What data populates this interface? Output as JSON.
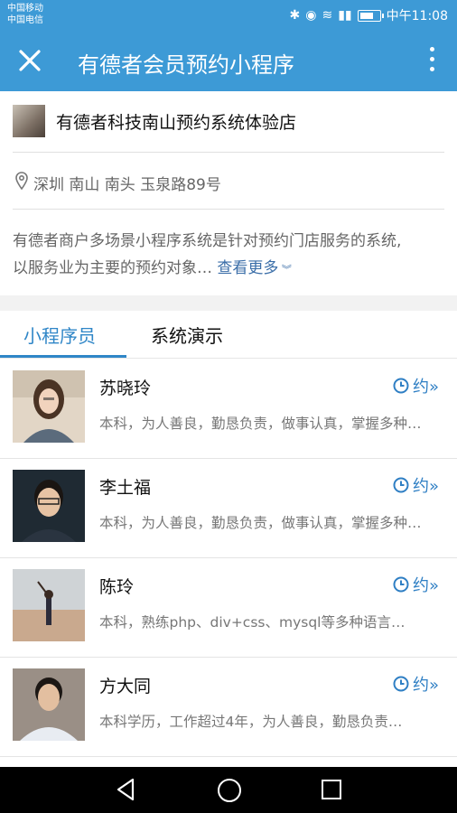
{
  "status": {
    "carrier1": "中国移动",
    "carrier2": "中国电信",
    "time": "中午11:08"
  },
  "nav": {
    "title": "有德者会员预约小程序"
  },
  "store": {
    "name": "有德者科技南山预约系统体验店",
    "address": "深圳 南山 南头 玉泉路89号",
    "desc_line1": "有德者商户多场景小程序系统是针对预约门店服务的系统,",
    "desc_line2": "以服务业为主要的预约对象…",
    "more": "查看更多"
  },
  "tabs": [
    {
      "label": "小程序员"
    },
    {
      "label": "系统演示"
    }
  ],
  "book_label": "约»",
  "staff": [
    {
      "name": "苏晓玲",
      "desc": "本科，为人善良，勤恳负责，做事认真，掌握多种技能…"
    },
    {
      "name": "李土福",
      "desc": "本科，为人善良，勤恳负责，做事认真，掌握多种技能…"
    },
    {
      "name": "陈玲",
      "desc": "本科，熟练php、div+css、mysql等多种语言…"
    },
    {
      "name": "方大同",
      "desc": "本科学历，工作超过4年，为人善良，勤恳负责…"
    }
  ]
}
